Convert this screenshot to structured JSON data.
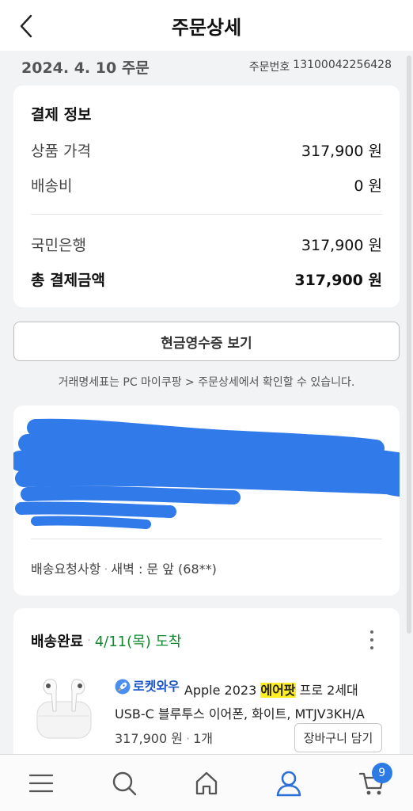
{
  "header": {
    "title": "주문상세",
    "back_icon": "chevron-left-icon"
  },
  "order": {
    "date": "2024. 4. 10 주문",
    "number_label": "주문번호",
    "number_value": "13100042256428"
  },
  "payment": {
    "title": "결제 정보",
    "rows": [
      {
        "label": "상품 가격",
        "value": "317,900 원"
      },
      {
        "label": "배송비",
        "value": "0 원"
      }
    ],
    "method": {
      "label": "국민은행",
      "value": "317,900 원"
    },
    "total": {
      "label": "총 결제금액",
      "value": "317,900 원"
    }
  },
  "receipt_button": "현금영수증 보기",
  "notice": "거래명세표는 PC 마이쿠팡 > 주문상세에서 확인할 수 있습니다.",
  "address": {
    "redaction_color": "#1f6fe8",
    "request_label": "배송요청사항",
    "request_value": "새벽 : 문 앞 (68**)"
  },
  "shipment": {
    "status": "배송완료",
    "arrival": "4/11(목) 도착",
    "arrival_color": "#118a2f",
    "product": {
      "badge": "로켓와우",
      "title_before": "Apple 2023",
      "title_highlight": "에어팟",
      "title_after": "프로 2세대 USB-C 블루투스 이어폰, 화이트, MTJV3KH/A",
      "price": "317,900 원",
      "quantity": "1개",
      "cart_button": "장바구니 담기"
    }
  },
  "nav": {
    "items": [
      "menu-icon",
      "search-icon",
      "home-icon",
      "user-icon",
      "cart-icon"
    ],
    "active_color": "#2c6fd6",
    "cart_count": "9"
  }
}
